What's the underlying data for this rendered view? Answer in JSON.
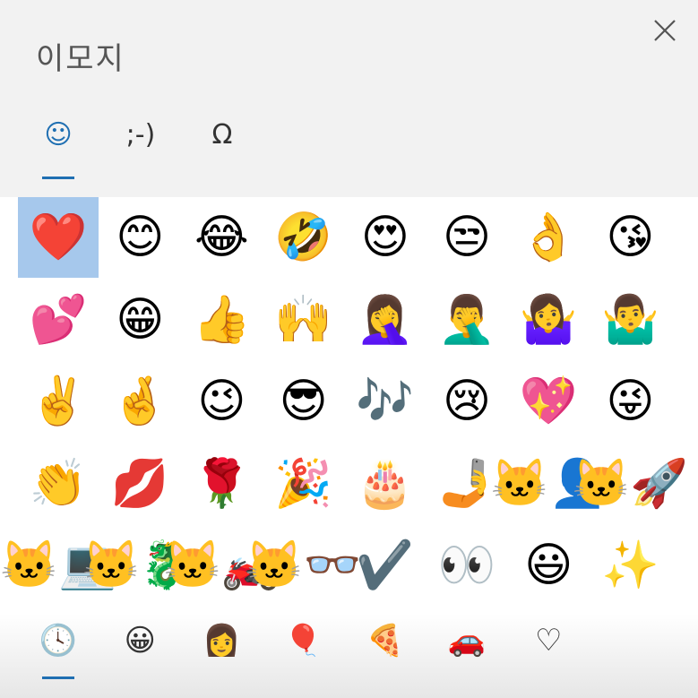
{
  "window": {
    "title": "이모지",
    "close_icon": "close-icon"
  },
  "tabs": [
    {
      "name": "emoji",
      "glyph": "☺",
      "active": true
    },
    {
      "name": "kaomoji",
      "glyph": ";-)",
      "active": false
    },
    {
      "name": "symbols",
      "glyph": "Ω",
      "active": false
    }
  ],
  "emoji_grid": [
    [
      "❤️",
      "😊",
      "😂",
      "🤣",
      "😍",
      "😒",
      "👌",
      "😘"
    ],
    [
      "💕",
      "😁",
      "👍",
      "🙌",
      "🤦‍♀️",
      "🤦‍♂️",
      "🤷‍♀️",
      "🤷‍♂️"
    ],
    [
      "✌️",
      "🤞",
      "😉",
      "😎",
      "🎶",
      "😢",
      "💖",
      "😜"
    ],
    [
      "👏",
      "💋",
      "🌹",
      "🎉",
      "🎂",
      "🤳",
      "🐱‍👤",
      "🐱‍🚀"
    ],
    [
      "🐱‍💻",
      "🐱‍🐉",
      "🐱‍🏍",
      "🐱‍👓",
      "✔️",
      "👀",
      "😃",
      "✨"
    ]
  ],
  "selected_cell": {
    "row": 0,
    "col": 0
  },
  "categories": [
    {
      "name": "recent",
      "glyph": "🕓",
      "active": true
    },
    {
      "name": "smileys",
      "glyph": "😀",
      "active": false
    },
    {
      "name": "people",
      "glyph": "👩",
      "active": false
    },
    {
      "name": "celebration",
      "glyph": "🎈",
      "active": false
    },
    {
      "name": "food",
      "glyph": "🍕",
      "active": false
    },
    {
      "name": "travel",
      "glyph": "🚗",
      "active": false
    },
    {
      "name": "symbols",
      "glyph": "♡",
      "active": false
    }
  ],
  "colors": {
    "accent": "#1f6fb2",
    "selection": "#a6c8ec",
    "header_bg": "#f2f2f2"
  }
}
